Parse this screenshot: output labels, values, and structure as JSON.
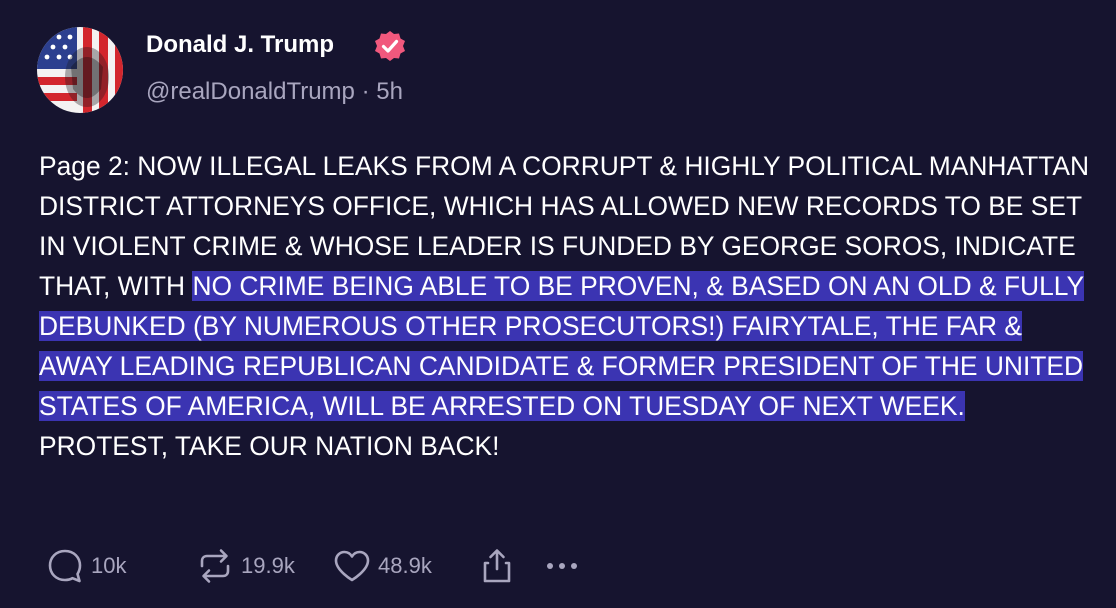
{
  "author": {
    "name": "Donald J. Trump",
    "handle": "@realDonaldTrump",
    "separator": "·",
    "time": "5h",
    "avatar_icon": "avatar-flag-portrait",
    "verified_icon": "verified-badge-icon"
  },
  "post": {
    "text_before": "Page 2: NOW ILLEGAL LEAKS FROM A CORRUPT & HIGHLY POLITICAL MANHATTAN DISTRICT ATTORNEYS OFFICE, WHICH HAS ALLOWED NEW RECORDS TO BE SET IN VIOLENT CRIME & WHOSE LEADER IS FUNDED BY GEORGE SOROS, INDICATE THAT, WITH ",
    "text_highlighted": "NO CRIME BEING ABLE TO BE PROVEN, & BASED ON AN OLD & FULLY DEBUNKED (BY NUMEROUS OTHER PROSECUTORS!) FAIRYTALE, THE FAR & AWAY LEADING REPUBLICAN CANDIDATE & FORMER PRESIDENT OF THE UNITED STATES OF AMERICA, WILL BE ARRESTED ON TUESDAY OF NEXT WEEK.",
    "text_after": "PROTEST, TAKE OUR NATION BACK!"
  },
  "actions": {
    "reply_count": "10k",
    "repost_count": "19.9k",
    "like_count": "48.9k"
  },
  "colors": {
    "background": "#16142f",
    "highlight": "#3b34b2",
    "verified": "#f1587d",
    "muted_text": "#a9a6bf"
  }
}
